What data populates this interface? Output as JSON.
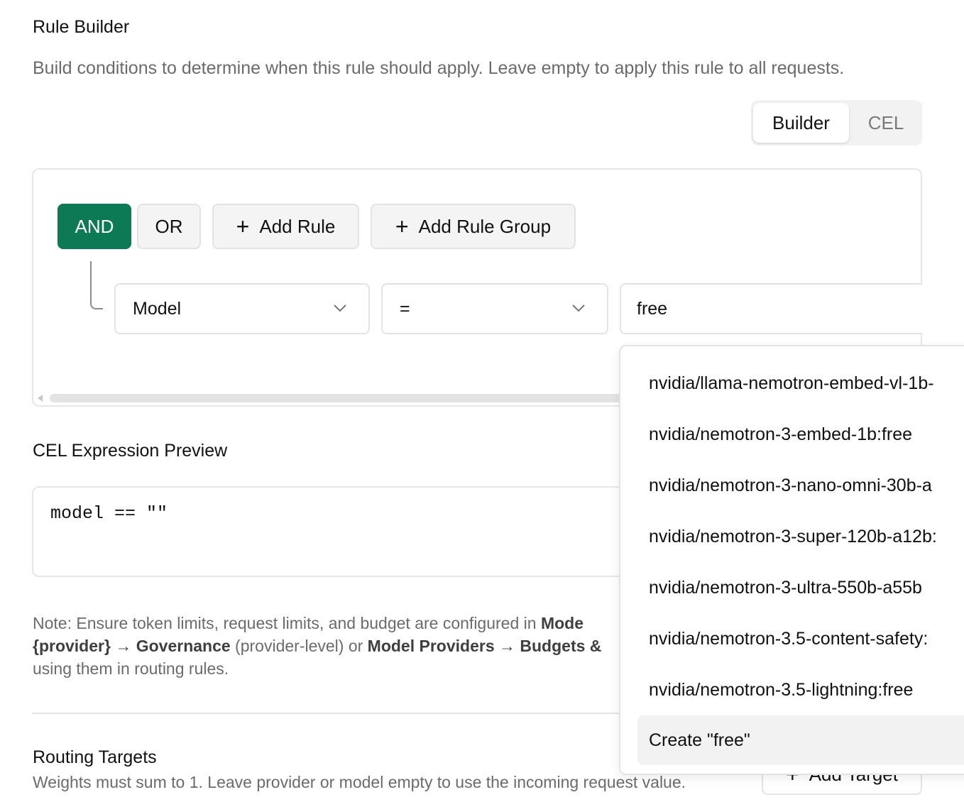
{
  "rule_builder": {
    "title": "Rule Builder",
    "description": "Build conditions to determine when this rule should apply. Leave empty to apply this rule to all requests.",
    "mode_tabs": [
      {
        "label": "Builder",
        "active": true
      },
      {
        "label": "CEL",
        "active": false
      }
    ]
  },
  "group": {
    "combinators": [
      {
        "label": "AND",
        "active": true
      },
      {
        "label": "OR",
        "active": false
      }
    ],
    "add_rule_label": "Add Rule",
    "add_group_label": "Add Rule Group"
  },
  "condition": {
    "field": "Model",
    "operator": "=",
    "value": "free"
  },
  "dropdown": {
    "options": [
      "nvidia/llama-nemotron-embed-vl-1b-",
      "nvidia/nemotron-3-embed-1b:free",
      "nvidia/nemotron-3-nano-omni-30b-a",
      "nvidia/nemotron-3-super-120b-a12b:",
      "nvidia/nemotron-3-ultra-550b-a55b",
      "nvidia/nemotron-3.5-content-safety:",
      "nvidia/nemotron-3.5-lightning:free"
    ],
    "create_label": "Create \"free\""
  },
  "cel_preview": {
    "title": "CEL Expression Preview",
    "expression": "model == \"\""
  },
  "note": {
    "prefix": "Note: Ensure token limits, request limits, and budget are configured in ",
    "bold1": "Mode",
    "bold2": "{provider}",
    "arrow": "→",
    "bold3": "Governance",
    "mid": " (provider-level) or ",
    "bold4": "Model Providers",
    "bold5": "Budgets &",
    "line3": "using them in routing rules."
  },
  "routing_targets": {
    "title": "Routing Targets",
    "description": "Weights must sum to 1. Leave provider or model empty to use the incoming request value.",
    "add_target_label": "Add Target"
  },
  "colors": {
    "accent": "#0b7a55",
    "muted_text": "#6b6b6b",
    "border": "#e3e3e3"
  }
}
